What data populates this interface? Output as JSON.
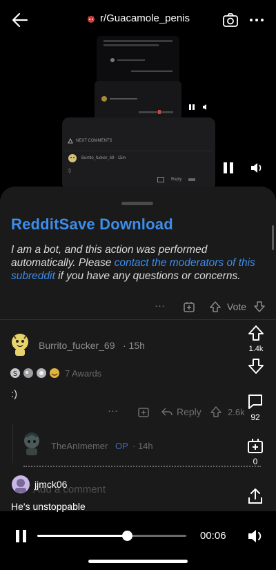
{
  "header": {
    "subreddit": "r/Guacamole_penis"
  },
  "mini_preview": {
    "next_comments": "NEXT COMMENTS",
    "user": "Burrito_fucker_69 · 15m",
    "text": ":)",
    "reply": "Reply"
  },
  "bot_comment": {
    "title": "RedditSave Download",
    "text_prefix": "I am a bot, and this action was performed automatically. Please ",
    "link_text": "contact the moderators of this subreddit",
    "text_suffix": " if you have any questions or concerns.",
    "more": "···",
    "vote_label": "Vote"
  },
  "comment": {
    "username": "Burrito_fucker_69",
    "time": "· 15h",
    "awards": "7 Awards",
    "text": ":)",
    "more": "···",
    "reply": "Reply",
    "votes": "2.6k"
  },
  "reply_preview": {
    "username": "TheAnImemer",
    "op": "OP",
    "time": "· 14h"
  },
  "add_comment_placeholder": "Add a comment",
  "side_actions": {
    "upvotes": "1.4k",
    "comments": "92",
    "awards": "0"
  },
  "poster": {
    "username": "jjmck06"
  },
  "caption": "He's unstoppable",
  "player": {
    "time": "00:06",
    "progress": 0.6
  },
  "colors": {
    "accent": "#3d8dea",
    "background": "#000000",
    "card": "#1a1a1b"
  }
}
